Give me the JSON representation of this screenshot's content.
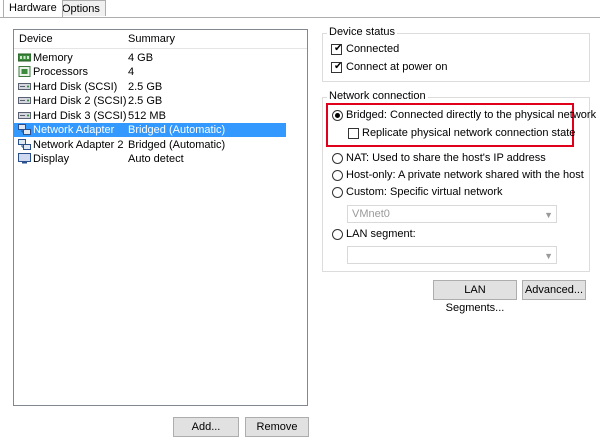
{
  "tabs": [
    {
      "label": "Hardware",
      "active": true
    },
    {
      "label": "Options",
      "active": false
    }
  ],
  "device_list": {
    "headers": {
      "device": "Device",
      "summary": "Summary"
    },
    "rows": [
      {
        "icon": "memory-icon",
        "device": "Memory",
        "summary": "4 GB",
        "selected": false
      },
      {
        "icon": "processor-icon",
        "device": "Processors",
        "summary": "4",
        "selected": false
      },
      {
        "icon": "hard-disk-icon",
        "device": "Hard Disk (SCSI)",
        "summary": "2.5 GB",
        "selected": false
      },
      {
        "icon": "hard-disk-icon",
        "device": "Hard Disk 2 (SCSI)",
        "summary": "2.5 GB",
        "selected": false
      },
      {
        "icon": "hard-disk-icon",
        "device": "Hard Disk 3 (SCSI)",
        "summary": "512 MB",
        "selected": false
      },
      {
        "icon": "network-adapter-icon",
        "device": "Network Adapter",
        "summary": "Bridged (Automatic)",
        "selected": true
      },
      {
        "icon": "network-adapter-icon",
        "device": "Network Adapter 2",
        "summary": "Bridged (Automatic)",
        "selected": false
      },
      {
        "icon": "display-icon",
        "device": "Display",
        "summary": "Auto detect",
        "selected": false
      }
    ]
  },
  "buttons": {
    "add": "Add...",
    "remove": "Remove",
    "lan_segments": "LAN Segments...",
    "advanced": "Advanced..."
  },
  "device_status": {
    "title": "Device status",
    "connected": {
      "label": "Connected",
      "checked": true
    },
    "connect_at_power_on": {
      "label": "Connect at power on",
      "checked": true
    }
  },
  "network_connection": {
    "title": "Network connection",
    "bridged": {
      "label": "Bridged: Connected directly to the physical network",
      "selected": true
    },
    "replicate": {
      "label": "Replicate physical network connection state",
      "checked": false
    },
    "nat": {
      "label": "NAT: Used to share the host's IP address",
      "selected": false
    },
    "host_only": {
      "label": "Host-only: A private network shared with the host",
      "selected": false
    },
    "custom": {
      "label": "Custom: Specific virtual network",
      "selected": false
    },
    "custom_value": "VMnet0",
    "lan_segment": {
      "label": "LAN segment:",
      "selected": false
    },
    "lan_segment_value": ""
  },
  "colors": {
    "selection": "#3399ff",
    "highlight_border": "#e0001b"
  }
}
